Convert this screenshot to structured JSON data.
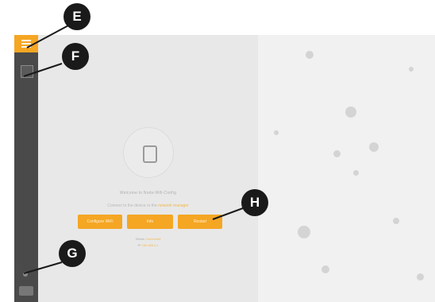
{
  "sidebar": {
    "icons": [
      "menu-icon",
      "grid-icon",
      "dot-icon",
      "logout-icon"
    ]
  },
  "main": {
    "device_icon": "plug-icon",
    "heading": "Welcome to Node-Wifi-Config",
    "subtext": "Connect to the device or the",
    "subtext_link": "network manager",
    "buttons": [
      {
        "label": "Configure WiFi"
      },
      {
        "label": "Info"
      },
      {
        "label": "Restart"
      }
    ],
    "footer_line1_label": "Status",
    "footer_line1_link": "Connected",
    "footer_line2_label": "IP",
    "footer_line2_link": "192.168.4.1"
  },
  "markers": {
    "e": "E",
    "f": "F",
    "g": "G",
    "h": "H"
  },
  "colors": {
    "accent": "#f5a623",
    "sidebar": "#4a4a4a",
    "panel": "#e8e8e8",
    "marker": "#1a1a1a"
  }
}
